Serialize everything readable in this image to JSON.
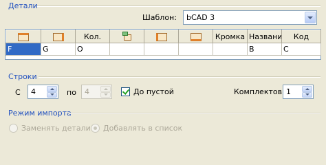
{
  "sections": {
    "details": "Детали",
    "rows": "Строки",
    "import_mode": "Режим импорта"
  },
  "template": {
    "label": "Шаблон:",
    "value": "bCAD 3"
  },
  "table": {
    "columns": [
      {
        "icon": "panel-top-edge-icon",
        "label": ""
      },
      {
        "icon": "panel-right-edge-icon",
        "label": ""
      },
      {
        "icon": "",
        "label": "Кол."
      },
      {
        "icon": "rotate-panel-icon",
        "label": ""
      },
      {
        "icon": "panel-left-edge-icon",
        "label": ""
      },
      {
        "icon": "panel-bottom-edge-icon",
        "label": ""
      },
      {
        "icon": "",
        "label": "Кромка"
      },
      {
        "icon": "",
        "label": "Название"
      },
      {
        "icon": "",
        "label": "Код"
      }
    ],
    "row": [
      "F",
      "G",
      "O",
      "",
      "",
      "",
      "",
      "B",
      "C"
    ]
  },
  "rows": {
    "from_label": "С",
    "from_value": "4",
    "to_label": "по",
    "to_value": "4",
    "until_empty_label": "До пустой",
    "until_empty_checked": true,
    "sets_label": "Комплектов",
    "sets_value": "1"
  },
  "import_mode": {
    "replace_label": "Заменять детали",
    "append_label": "Добавлять в список",
    "selected": "append"
  }
}
